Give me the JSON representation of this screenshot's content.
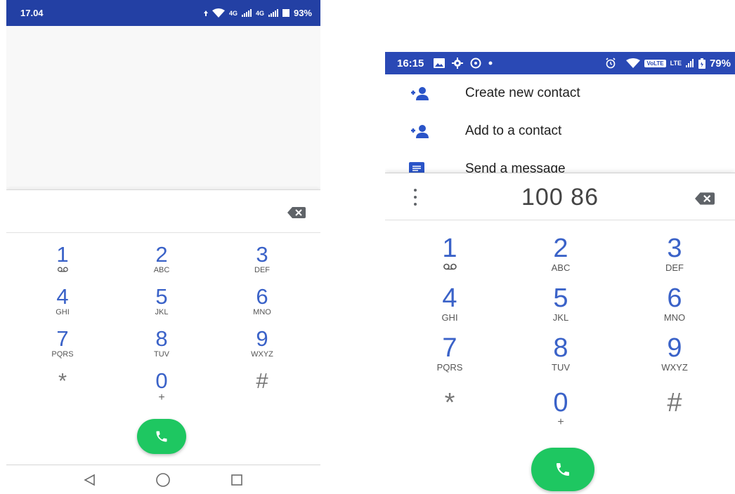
{
  "left_phone": {
    "status_bar": {
      "time": "17.04",
      "network_label_1": "4G",
      "network_label_2": "4G",
      "battery_text": "93%",
      "icons": [
        "data-arrow-icon",
        "wifi-icon",
        "signal-icon",
        "signal-icon",
        "battery-icon"
      ]
    },
    "digits": "",
    "keys": [
      {
        "digit": "1",
        "letters": "",
        "voicemail": true
      },
      {
        "digit": "2",
        "letters": "ABC"
      },
      {
        "digit": "3",
        "letters": "DEF"
      },
      {
        "digit": "4",
        "letters": "GHI"
      },
      {
        "digit": "5",
        "letters": "JKL"
      },
      {
        "digit": "6",
        "letters": "MNO"
      },
      {
        "digit": "7",
        "letters": "PQRS"
      },
      {
        "digit": "8",
        "letters": "TUV"
      },
      {
        "digit": "9",
        "letters": "WXYZ"
      },
      {
        "digit": "*",
        "letters": ""
      },
      {
        "digit": "0",
        "letters": "+"
      },
      {
        "digit": "#",
        "letters": ""
      }
    ],
    "nav_bar": [
      "back-icon",
      "home-icon",
      "recents-icon"
    ]
  },
  "right_phone": {
    "status_bar": {
      "time": "16:15",
      "volte_badge": "VoLTE",
      "lte_label": "LTE",
      "battery_text": "79%",
      "icons": [
        "image-icon",
        "gear-icon",
        "hotspot-icon",
        "dot-icon",
        "alarm-icon",
        "wifi-icon",
        "signal-icon",
        "battery-icon"
      ]
    },
    "suggestions": [
      {
        "label": "Create new contact",
        "icon": "add-person-icon"
      },
      {
        "label": "Add to a contact",
        "icon": "add-person-icon"
      },
      {
        "label": "Send a message",
        "icon": "message-icon"
      }
    ],
    "digits": "100 86",
    "keys": [
      {
        "digit": "1",
        "letters": "",
        "voicemail": true
      },
      {
        "digit": "2",
        "letters": "ABC"
      },
      {
        "digit": "3",
        "letters": "DEF"
      },
      {
        "digit": "4",
        "letters": "GHI"
      },
      {
        "digit": "5",
        "letters": "JKL"
      },
      {
        "digit": "6",
        "letters": "MNO"
      },
      {
        "digit": "7",
        "letters": "PQRS"
      },
      {
        "digit": "8",
        "letters": "TUV"
      },
      {
        "digit": "9",
        "letters": "WXYZ"
      },
      {
        "digit": "*",
        "letters": ""
      },
      {
        "digit": "0",
        "letters": "+"
      },
      {
        "digit": "#",
        "letters": ""
      }
    ]
  },
  "colors": {
    "status_bar_left": "#2340a4",
    "status_bar_right": "#2a49b5",
    "key_digit": "#3a62c8",
    "call_button": "#1ec761",
    "icon_accent": "#2a54c8"
  }
}
